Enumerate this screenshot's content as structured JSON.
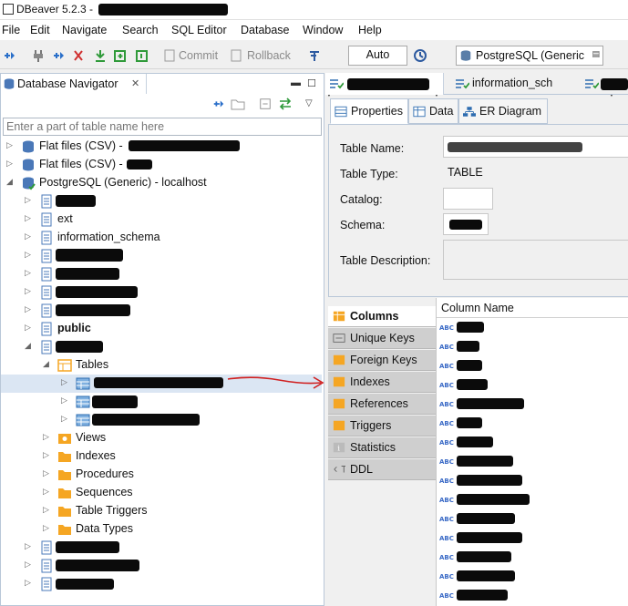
{
  "window": {
    "title": "DBeaver 5.2.3 - "
  },
  "menu": [
    "File",
    "Edit",
    "Navigate",
    "Search",
    "SQL Editor",
    "Database",
    "Window",
    "Help"
  ],
  "toolbar": {
    "commit_label": "Commit",
    "rollback_label": "Rollback",
    "transaction_mode": "Auto",
    "connection": "PostgreSQL (Generic"
  },
  "navigator": {
    "tab_label": "Database Navigator",
    "filter_placeholder": "Enter a part of table name here",
    "items": [
      {
        "label": "Flat files (CSV) - "
      },
      {
        "label": "Flat files (CSV) - "
      },
      {
        "label": "PostgreSQL (Generic) - localhost"
      },
      {
        "label": ""
      },
      {
        "label": "ext"
      },
      {
        "label": "information_schema"
      },
      {
        "label": ""
      },
      {
        "label": ""
      },
      {
        "label": ""
      },
      {
        "label": ""
      },
      {
        "label": "public"
      },
      {
        "label": ""
      },
      {
        "label": "Tables"
      },
      {
        "label": ""
      },
      {
        "label": ""
      },
      {
        "label": ""
      },
      {
        "label": "Views"
      },
      {
        "label": "Indexes"
      },
      {
        "label": "Procedures"
      },
      {
        "label": "Sequences"
      },
      {
        "label": "Table Triggers"
      },
      {
        "label": "Data Types"
      },
      {
        "label": ""
      },
      {
        "label": ""
      },
      {
        "label": ""
      }
    ]
  },
  "editor": {
    "tabs": [
      "",
      "information_sch",
      ""
    ],
    "subtabs": [
      "Properties",
      "Data",
      "ER Diagram"
    ],
    "properties": {
      "table_name_label": "Table Name:",
      "table_type_label": "Table Type:",
      "table_type_value": "TABLE",
      "catalog_label": "Catalog:",
      "schema_label": "Schema:",
      "description_label": "Table Description:"
    },
    "side_tabs": [
      "Columns",
      "Unique Keys",
      "Foreign Keys",
      "Indexes",
      "References",
      "Triggers",
      "Statistics",
      "DDL"
    ],
    "column_header": "Column Name",
    "column_type_badge": "ABC"
  },
  "colors": {
    "accent": "#3a6ac6",
    "arrow": "#d02020",
    "folder": "#f5a623"
  }
}
